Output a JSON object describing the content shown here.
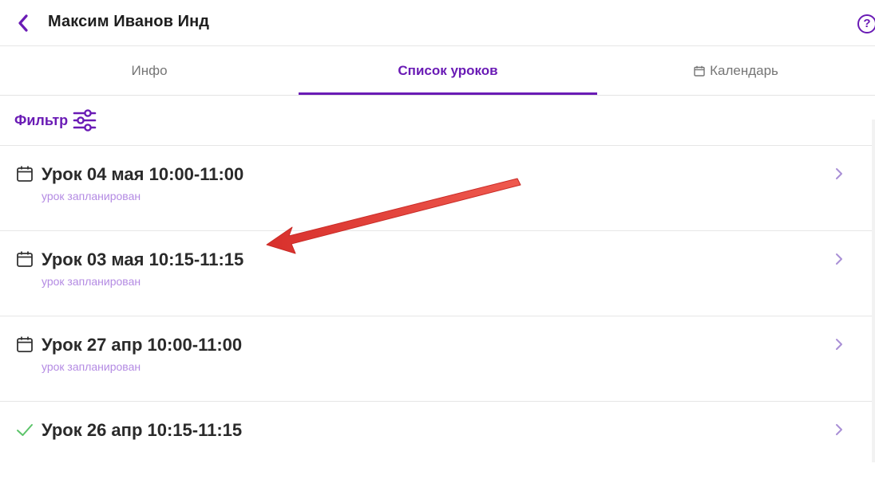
{
  "header": {
    "title": "Максим Иванов Инд",
    "help_label": "?"
  },
  "tabs": [
    {
      "label": "Инфо",
      "active": false
    },
    {
      "label": "Список уроков",
      "active": true
    },
    {
      "label": "Календарь",
      "active": false
    }
  ],
  "filter": {
    "label": "Фильтр"
  },
  "lessons": [
    {
      "title": "Урок 04 мая 10:00-11:00",
      "status": "урок запланирован",
      "icon": "calendar-icon"
    },
    {
      "title": "Урок 03 мая 10:15-11:15",
      "status": "урок запланирован",
      "icon": "calendar-icon"
    },
    {
      "title": "Урок 27 апр 10:00-11:00",
      "status": "урок запланирован",
      "icon": "calendar-icon"
    },
    {
      "title": "Урок 26 апр 10:15-11:15",
      "status": "",
      "icon": "check-icon"
    }
  ],
  "colors": {
    "accent": "#6a1bb5",
    "status_text": "#b48be3",
    "done_check": "#5cc46a",
    "annotation_arrow": "#e03a34"
  }
}
